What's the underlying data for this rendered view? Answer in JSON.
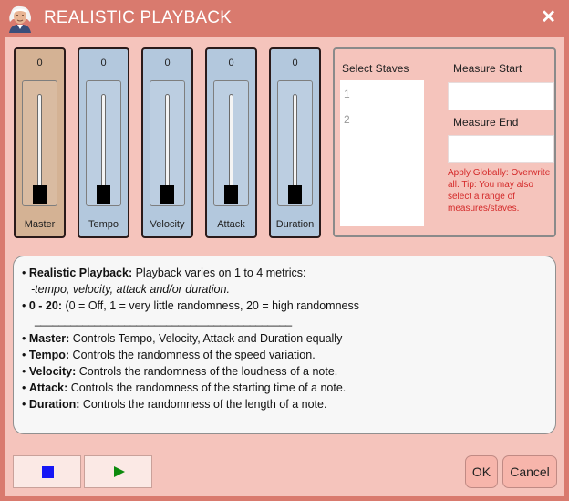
{
  "window": {
    "title": "REALISTIC PLAYBACK",
    "close_glyph": "✕",
    "logo_icon": "composer-portrait-icon"
  },
  "sliders": [
    {
      "value": "0",
      "label": "Master",
      "level": 0,
      "color": "#d4b294"
    },
    {
      "value": "0",
      "label": "Tempo",
      "level": 0,
      "color": "#b3c8dd"
    },
    {
      "value": "0",
      "label": "Velocity",
      "level": 0,
      "color": "#b3c8dd"
    },
    {
      "value": "0",
      "label": "Attack",
      "level": 0,
      "color": "#b3c8dd"
    },
    {
      "value": "0",
      "label": "Duration",
      "level": 0,
      "color": "#b3c8dd"
    }
  ],
  "staves": {
    "label": "Select Staves",
    "items": [
      "1",
      "2"
    ]
  },
  "measure": {
    "start_label": "Measure Start",
    "start_value": "",
    "end_label": "Measure End",
    "end_value": "",
    "note": "Apply Globally: Overwrite all. Tip: You may also select a range of measures/staves.",
    "note_color": "#d42a2a"
  },
  "help": {
    "l1_bold": "Realistic Playback:",
    "l1_text": " Playback varies on 1 to 4 metrics:",
    "l2_text": "-tempo, velocity, attack and/or duration.",
    "l3_bold": "0 - 20:",
    "l3_text": " (0 = Off, 1 = very little randomness, 20 = high randomness",
    "divider": "___________________________________________",
    "l5_bold": "Master:",
    "l5_text": " Controls Tempo, Velocity, Attack and Duration equally",
    "l6_bold": "Tempo:",
    "l6_text": " Controls the randomness of the speed variation.",
    "l7_bold": "Velocity:",
    "l7_text": " Controls the randomness of the loudness of a note.",
    "l8_bold": "Attack:",
    "l8_text": " Controls the randomness of the starting time of a note.",
    "l9_bold": "Duration:",
    "l9_text": " Controls the randomness of the length of a note."
  },
  "controls": {
    "stop_icon": "stop-icon",
    "play_icon": "play-icon",
    "ok_label": "OK",
    "cancel_label": "Cancel"
  },
  "colors": {
    "titlebar": "#d97a6e",
    "client": "#f5c4bc",
    "stop": "#1616f5",
    "play": "#0d8a0d"
  }
}
